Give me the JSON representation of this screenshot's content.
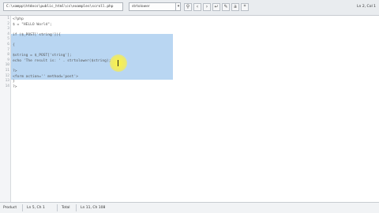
{
  "toolbar": {
    "path": "C:\\xampp\\htdocs\\public_html\\cs\\examples\\scroll.php",
    "search_value": "strtolower",
    "top_right": "Ln 2, Col 1"
  },
  "editor": {
    "lines": [
      {
        "num": "1",
        "text": "<?php"
      },
      {
        "num": "2",
        "text": "$ = \"HELLO World\";"
      },
      {
        "num": "3",
        "text": ""
      },
      {
        "num": "4",
        "text": "if ($_POST['string']){"
      },
      {
        "num": "5",
        "text": ""
      },
      {
        "num": "6",
        "text": "{"
      },
      {
        "num": "7",
        "text": ""
      },
      {
        "num": "8",
        "text": "$string = $_POST['string'];"
      },
      {
        "num": "9",
        "text": "echo 'The result is: ' . strtolower($string);"
      },
      {
        "num": "10",
        "text": ""
      },
      {
        "num": "11",
        "text": "?>"
      },
      {
        "num": "12",
        "text": "<form action='' method='post'>"
      },
      {
        "num": "13",
        "text": "}"
      },
      {
        "num": "14",
        "text": "?>"
      }
    ]
  },
  "statusbar": {
    "mode": "Product",
    "position": "Ln 5, Ch 1",
    "total": "Total",
    "col": "Ln 11, Ch 108"
  }
}
